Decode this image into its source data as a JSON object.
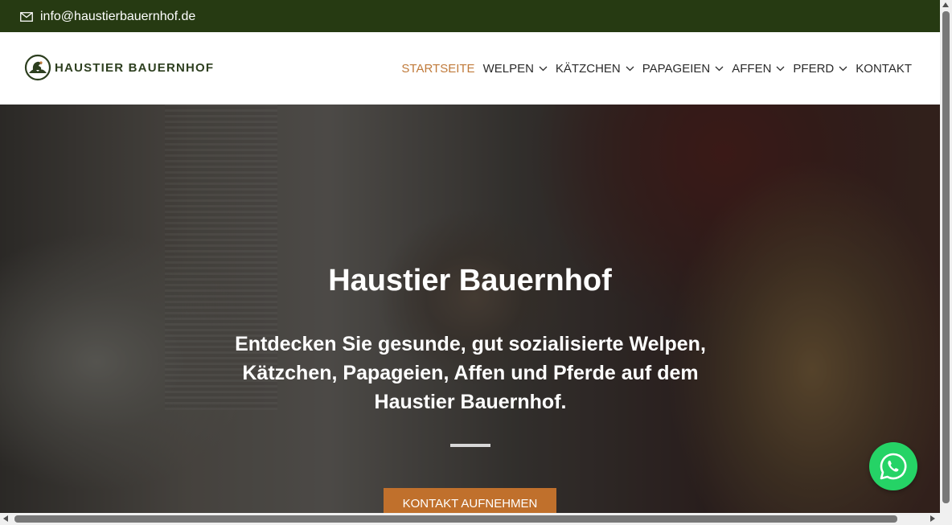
{
  "topbar": {
    "email": "info@haustierbauernhof.de",
    "icon": "mail-icon",
    "bg_color": "#263a12"
  },
  "header": {
    "logo_text": "HAUSTIER BAUERNHOF",
    "logo_icon": "farm-logo-icon"
  },
  "nav": {
    "items": [
      {
        "label": "STARTSEITE",
        "active": true,
        "dropdown": false
      },
      {
        "label": "WELPEN",
        "active": false,
        "dropdown": true
      },
      {
        "label": "KÄTZCHEN",
        "active": false,
        "dropdown": true
      },
      {
        "label": "PAPAGEIEN",
        "active": false,
        "dropdown": true
      },
      {
        "label": "AFFEN",
        "active": false,
        "dropdown": true
      },
      {
        "label": "PFERD",
        "active": false,
        "dropdown": true
      },
      {
        "label": "KONTAKT",
        "active": false,
        "dropdown": false
      }
    ],
    "active_color": "#c07a3a"
  },
  "hero": {
    "title": "Haustier Bauernhof",
    "subtitle": "Entdecken Sie gesunde, gut sozialisierte Welpen, Kätzchen, Papageien, Affen und Pferde auf dem Haustier Bauernhof.",
    "cta_label": "KONTAKT AUFNEHMEN",
    "cta_color": "#c0702c"
  },
  "whatsapp": {
    "icon": "whatsapp-icon",
    "color": "#25d366"
  }
}
